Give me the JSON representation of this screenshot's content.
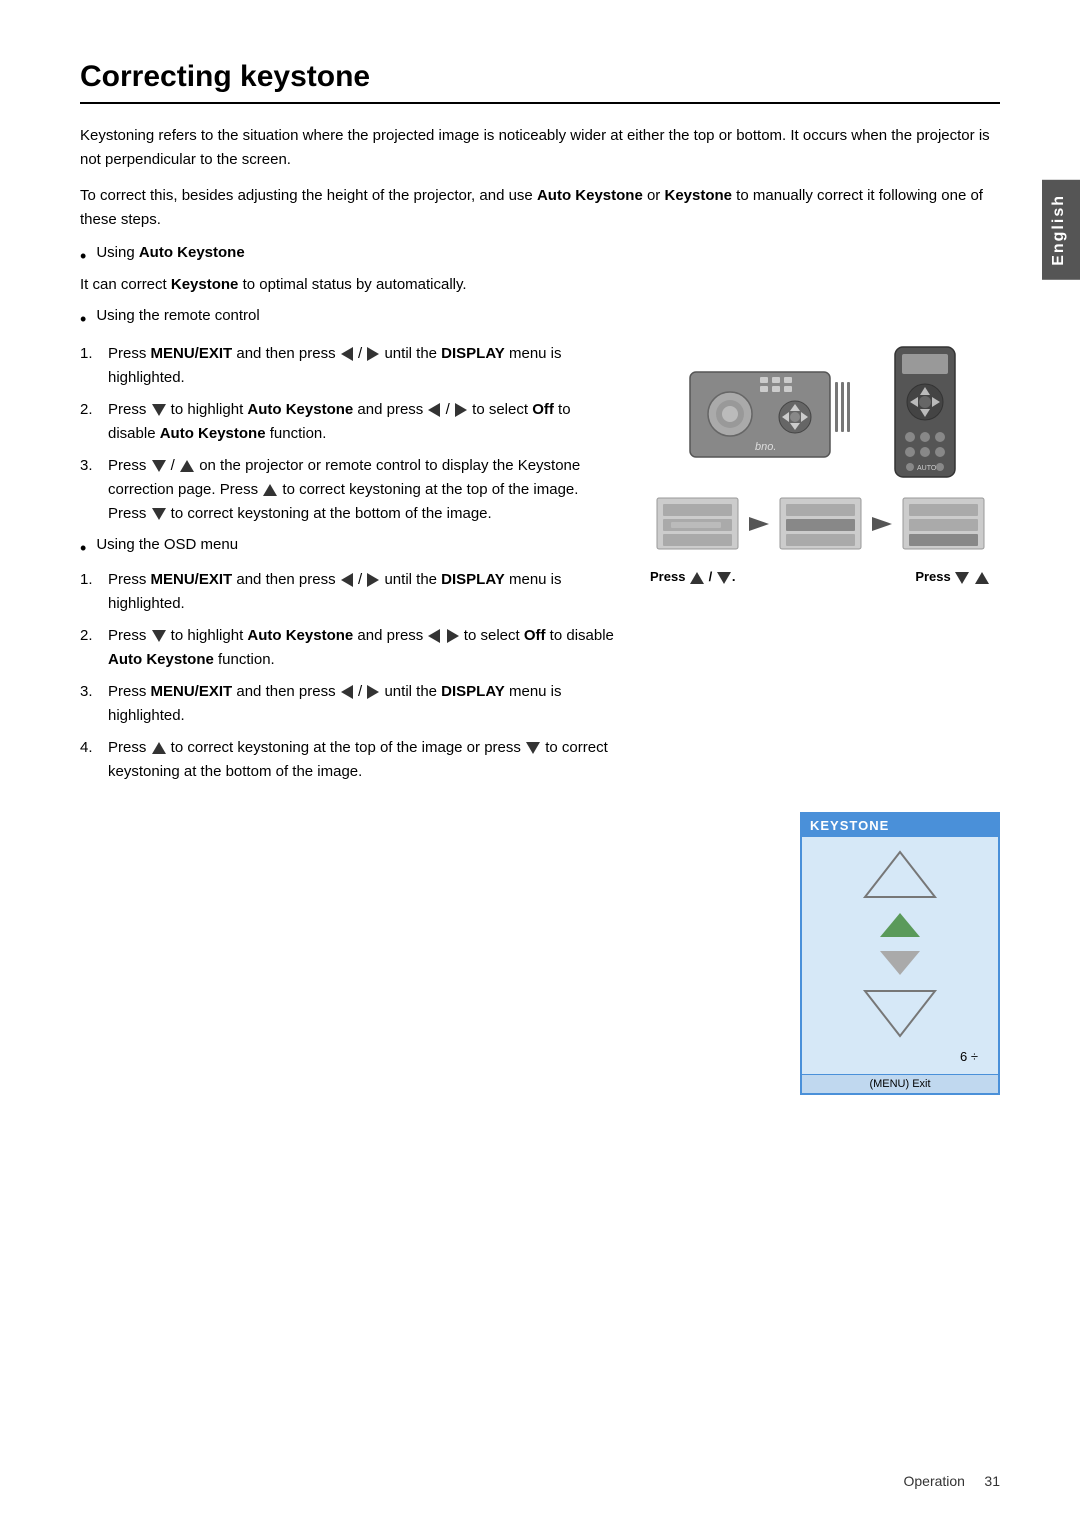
{
  "page": {
    "title": "Correcting keystone",
    "tab_label": "English",
    "footer_label": "Operation",
    "footer_page": "31"
  },
  "content": {
    "intro1": "Keystoning refers to the situation where the projected image is noticeably wider at either the top or bottom. It occurs when the projector is not perpendicular to the screen.",
    "intro2": "To correct this, besides adjusting the height of the projector, and use Auto Keystone or Keystone to manually correct it following one of these steps.",
    "auto_keystone_bullet": "Using Auto Keystone",
    "auto_keystone_desc": "It can correct Keystone to optimal status by automatically.",
    "remote_control_bullet": "Using the remote control",
    "remote_steps": [
      {
        "num": "1.",
        "text": "Press MENU/EXIT and then press ◄ / ► until the DISPLAY menu is highlighted."
      },
      {
        "num": "2.",
        "text": "Press ▼ to highlight Auto Keystone and press ◄ / ► to select Off to disable Auto Keystone function."
      },
      {
        "num": "3.",
        "text": "Press ▼ / ▲ on the projector or remote control to display the Keystone correction page. Press ▲ to correct keystoning at the top of the image. Press ▼ to correct keystoning at the bottom of the image."
      }
    ],
    "osd_bullet": "Using the OSD menu",
    "osd_steps": [
      {
        "num": "1.",
        "text": "Press MENU/EXIT and then press ◄ / ► until the DISPLAY menu is highlighted."
      },
      {
        "num": "2.",
        "text": "Press ▼ to highlight Auto Keystone and press /◄ ► to select Off to disable Auto Keystone function."
      },
      {
        "num": "3.",
        "text": "Press MENU/EXIT and then press ◄ / ► until the DISPLAY menu is highlighted."
      },
      {
        "num": "4.",
        "text": "Press ▲ to correct keystoning at the top of the image or press ▼ to correct keystoning at the bottom of the image."
      }
    ],
    "press_label1": "Press ▲ / ▼.",
    "press_label2": "Press ▼ ▲",
    "keystone": {
      "header": "KEYSTONE",
      "value": "6 ÷",
      "footer": "(MENU) Exit"
    }
  }
}
